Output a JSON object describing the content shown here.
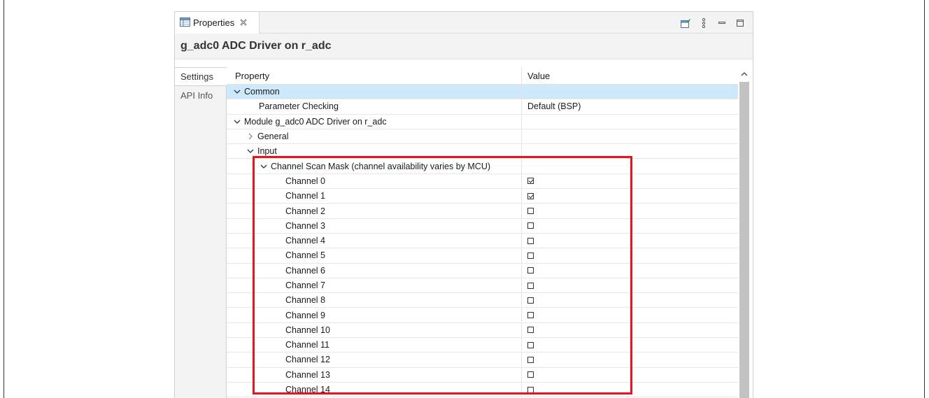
{
  "view_tab": {
    "label": "Properties",
    "close_icon": "close-icon"
  },
  "toolbar": {
    "icons": [
      "pin-editor-icon",
      "view-menu-icon",
      "minimize-icon",
      "maximize-icon"
    ]
  },
  "title": "g_adc0 ADC Driver on r_adc",
  "side_tabs": [
    {
      "label": "Settings",
      "active": true
    },
    {
      "label": "API Info",
      "active": false
    }
  ],
  "columns": {
    "property": "Property",
    "value": "Value"
  },
  "rows": [
    {
      "label": "Common",
      "indent": 0,
      "expander": "down",
      "value": "",
      "selected": true
    },
    {
      "label": "Parameter Checking",
      "indent": 2,
      "expander": "none",
      "value": "Default (BSP)"
    },
    {
      "label": "Module g_adc0 ADC Driver on r_adc",
      "indent": 0,
      "expander": "down",
      "value": ""
    },
    {
      "label": "General",
      "indent": 1,
      "expander": "right",
      "value": ""
    },
    {
      "label": "Input",
      "indent": 1,
      "expander": "down",
      "value": ""
    },
    {
      "label": "Channel Scan Mask (channel availability varies by MCU)",
      "indent": 2,
      "expander": "down",
      "value": ""
    },
    {
      "label": "Channel 0",
      "indent": 4,
      "expander": "none",
      "checkbox": true,
      "checked": true
    },
    {
      "label": "Channel 1",
      "indent": 4,
      "expander": "none",
      "checkbox": true,
      "checked": true
    },
    {
      "label": "Channel 2",
      "indent": 4,
      "expander": "none",
      "checkbox": true,
      "checked": false
    },
    {
      "label": "Channel 3",
      "indent": 4,
      "expander": "none",
      "checkbox": true,
      "checked": false
    },
    {
      "label": "Channel 4",
      "indent": 4,
      "expander": "none",
      "checkbox": true,
      "checked": false
    },
    {
      "label": "Channel 5",
      "indent": 4,
      "expander": "none",
      "checkbox": true,
      "checked": false
    },
    {
      "label": "Channel 6",
      "indent": 4,
      "expander": "none",
      "checkbox": true,
      "checked": false
    },
    {
      "label": "Channel 7",
      "indent": 4,
      "expander": "none",
      "checkbox": true,
      "checked": false
    },
    {
      "label": "Channel 8",
      "indent": 4,
      "expander": "none",
      "checkbox": true,
      "checked": false
    },
    {
      "label": "Channel 9",
      "indent": 4,
      "expander": "none",
      "checkbox": true,
      "checked": false
    },
    {
      "label": "Channel 10",
      "indent": 4,
      "expander": "none",
      "checkbox": true,
      "checked": false
    },
    {
      "label": "Channel 11",
      "indent": 4,
      "expander": "none",
      "checkbox": true,
      "checked": false
    },
    {
      "label": "Channel 12",
      "indent": 4,
      "expander": "none",
      "checkbox": true,
      "checked": false
    },
    {
      "label": "Channel 13",
      "indent": 4,
      "expander": "none",
      "checkbox": true,
      "checked": false
    },
    {
      "label": "Channel 14",
      "indent": 4,
      "expander": "none",
      "checkbox": true,
      "checked": false
    }
  ],
  "colors": {
    "highlight": "#e5141e",
    "selected_row": "#cce8fa",
    "scroll_thumb": "#c2c2c2"
  }
}
